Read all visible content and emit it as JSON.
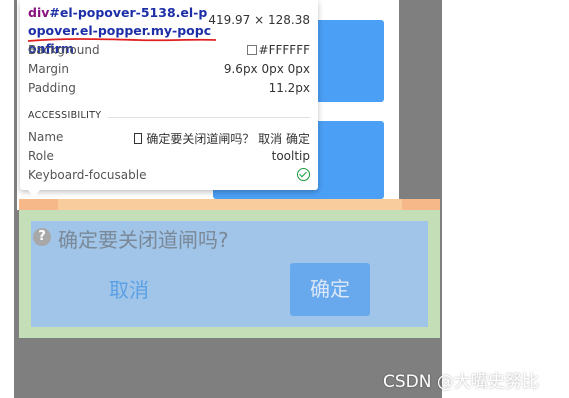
{
  "popconfirm": {
    "question": "确定要关闭道闸吗?",
    "cancel": "取消",
    "confirm": "确定"
  },
  "devtools_tooltip": {
    "selector_tag": "div",
    "selector_rest": "#el-popover-5138.el-popover.el-popper.my-popconfirm",
    "dimensions": "419.97 × 128.38",
    "background_label": "Background",
    "background_value": "#FFFFFF",
    "margin_label": "Margin",
    "margin_value": "9.6px 0px 0px",
    "padding_label": "Padding",
    "padding_value": "11.2px",
    "accessibility_heading": "ACCESSIBILITY",
    "name_label": "Name",
    "name_value": "确定要关闭道闸吗？ 取消 确定",
    "role_label": "Role",
    "role_value": "tooltip",
    "keyboard_label": "Keyboard-focusable"
  },
  "watermark": "CSDN @大嘴史努比",
  "colors": {
    "primary_button": "#4b9ff5",
    "highlight_content": "#a0c5e8",
    "highlight_padding": "#c4dfb8",
    "highlight_margin": "#f6b889",
    "selector_tag": "#881280",
    "selector_class": "#1d2fa8",
    "check_green": "#1a9a3c"
  },
  "icons": [
    "question-circle-icon",
    "color-swatch-icon",
    "check-circle-icon"
  ]
}
